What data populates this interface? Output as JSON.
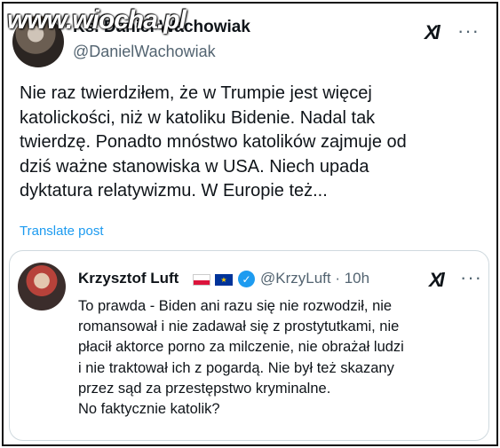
{
  "watermark": "www.wiocha.pl",
  "main_tweet": {
    "author_name": "Ks. Daniel Wachowiak",
    "handle": "@DanielWachowiak",
    "text_lines": [
      "Nie raz twierdziłem, że w Trumpie jest więcej",
      "katolickości, niż w katoliku Bidenie. Nadal tak",
      "twierdzę. Ponadto mnóstwo katolików zajmuje od",
      "dziś ważne stanowiska w USA. Niech upada",
      "dyktatura relatywizmu. W Europie też..."
    ],
    "translate_label": "Translate post"
  },
  "quoted_tweet": {
    "author_name": "Krzysztof Luft",
    "handle_time": "@KrzyLuft · 10h",
    "text_lines": [
      "To prawda - Biden ani razu się nie rozwodził, nie",
      "romansował i nie zadawał się z prostytutkami, nie",
      "płacił aktorce porno za milczenie, nie obrażał ludzi",
      "i nie traktował ich z pogardą. Nie był też skazany",
      "przez sąd za przestępstwo kryminalne.",
      "No faktycznie katolik?"
    ]
  },
  "icons": {
    "grok": "Xl",
    "more": "···",
    "verified": "✓",
    "eu_stars": "★"
  },
  "colors": {
    "link_blue": "#1d9bf0",
    "secondary_text": "#536471"
  }
}
